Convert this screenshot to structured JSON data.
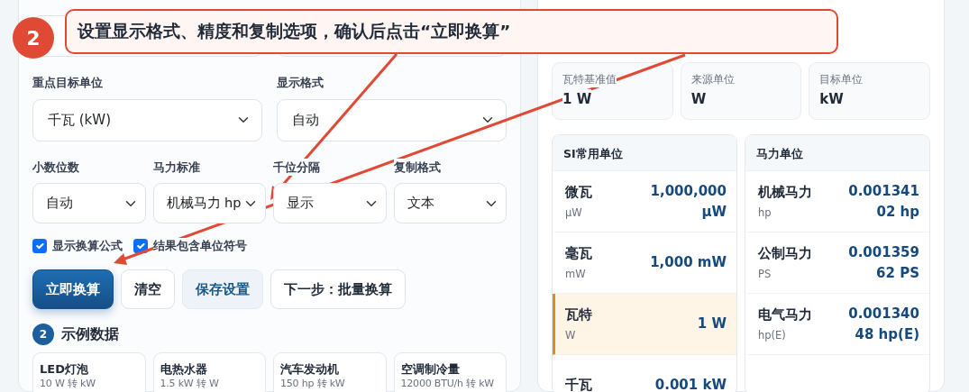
{
  "guide": {
    "step": "2",
    "callout": "设置显示格式、精度和复制选项，确认后点击“立即换算”"
  },
  "settings": {
    "fields": [
      {
        "label": "重点目标单位",
        "value": "千瓦 (kW)"
      },
      {
        "label": "显示格式",
        "value": "自动"
      }
    ],
    "options": [
      {
        "label": "小数位数",
        "value": "自动"
      },
      {
        "label": "马力标准",
        "value": "机械马力 hp"
      },
      {
        "label": "千位分隔",
        "value": "显示"
      },
      {
        "label": "复制格式",
        "value": "文本"
      }
    ],
    "checkboxes": [
      {
        "label": "显示换算公式",
        "checked": true
      },
      {
        "label": "结果包含单位符号",
        "checked": true
      }
    ],
    "buttons": [
      {
        "label": "立即换算",
        "kind": "primary"
      },
      {
        "label": "清空",
        "kind": "outline"
      },
      {
        "label": "保存设置",
        "kind": "soft"
      },
      {
        "label": "下一步：批量换算",
        "kind": "outline"
      }
    ]
  },
  "examples": {
    "step": "2",
    "title": "示例数据",
    "items": [
      {
        "title": "LED灯泡",
        "subtitle": "10 W 转 kW"
      },
      {
        "title": "电热水器",
        "subtitle": "1.5 kW 转 W"
      },
      {
        "title": "汽车发动机",
        "subtitle": "150 hp 转 kW"
      },
      {
        "title": "空调制冷量",
        "subtitle": "12000 BTU/h 转 kW"
      }
    ]
  },
  "summary": [
    {
      "label": "瓦特基准值",
      "value": "1 W"
    },
    {
      "label": "来源单位",
      "value": "W"
    },
    {
      "label": "目标单位",
      "value": "kW"
    }
  ],
  "groups": [
    {
      "title": "SI常用单位",
      "rows": [
        {
          "name": "微瓦",
          "symbol": "µW",
          "value": "1,000,000 µW",
          "selected": false
        },
        {
          "name": "毫瓦",
          "symbol": "mW",
          "value": "1,000 mW",
          "selected": false
        },
        {
          "name": "瓦特",
          "symbol": "W",
          "value": "1 W",
          "selected": true
        },
        {
          "name": "千瓦",
          "value": "0.001 kW",
          "selected": false
        }
      ]
    },
    {
      "title": "马力单位",
      "rows": [
        {
          "name": "机械马力",
          "symbol": "hp",
          "value": "0.00134102 hp",
          "selected": false
        },
        {
          "name": "公制马力",
          "symbol": "PS",
          "value": "0.00135962 PS",
          "selected": false
        },
        {
          "name": "电气马力",
          "symbol": "hp(E)",
          "value": "0.00134048 hp(E)",
          "selected": false
        }
      ]
    }
  ]
}
